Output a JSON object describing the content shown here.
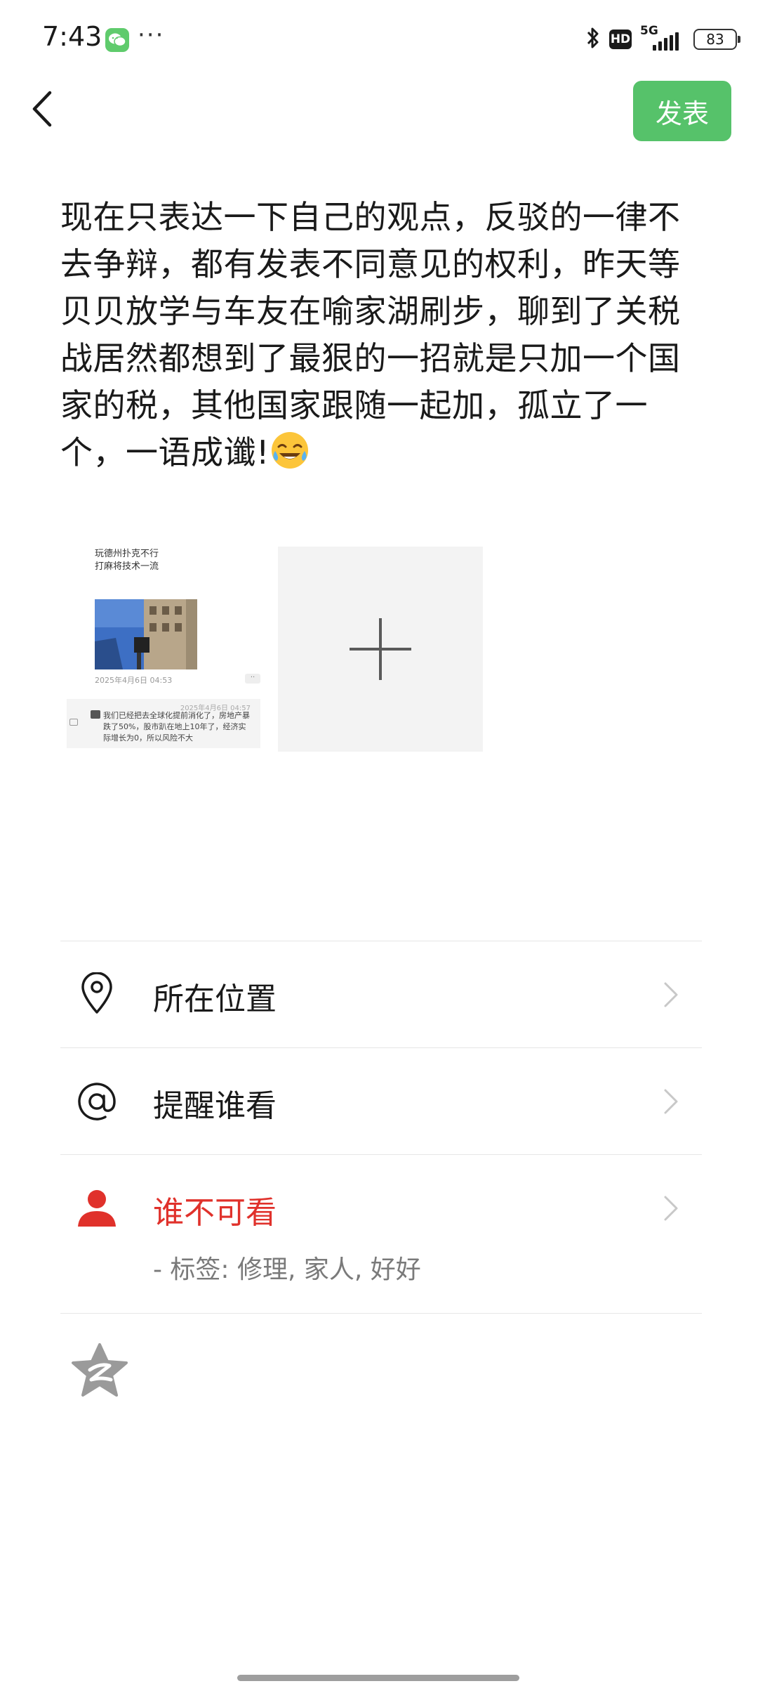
{
  "status_bar": {
    "time": "7:43",
    "more": "···",
    "hd": "HD",
    "network": "5G",
    "battery": "83"
  },
  "header": {
    "publish_label": "发表"
  },
  "post": {
    "text": "现在只表达一下自己的观点，反驳的一律不去争辩，都有发表不同意见的权利，昨天等贝贝放学与车友在喻家湖刷步，聊到了关税战居然都想到了最狠的一招就是只加一个国家的税，其他国家跟随一起加，孤立了一个，一语成谶!"
  },
  "attached_image": {
    "line1": "玩德州扑克不行",
    "line2": "打麻将技术一流",
    "date": "2025年4月6日 04:53",
    "dots": "··",
    "card_date": "2025年4月6日 04:57",
    "card_text": "我们已经把去全球化提前消化了，房地产暴跌了50%，股市趴在地上10年了，经济实际增长为0，所以风险不大"
  },
  "options": {
    "location_label": "所在位置",
    "mention_label": "提醒谁看",
    "visibility_label": "谁不可看",
    "visibility_tags": "- 标签: 修理, 家人, 好好"
  },
  "colors": {
    "accent_green": "#56c26a",
    "warning_red": "#e0312b"
  }
}
